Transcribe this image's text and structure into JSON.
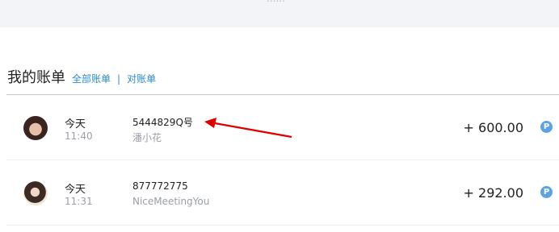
{
  "banner": {
    "text": "......"
  },
  "section": {
    "title": "我的账单",
    "link_all": "全部账单",
    "separator": "|",
    "link_reconcile": "对账单"
  },
  "rows": [
    {
      "day": "今天",
      "time": "11:40",
      "account": "5444829Q号",
      "name": "潘小花",
      "amount": "+ 600.00",
      "pay_icon": "P"
    },
    {
      "day": "今天",
      "time": "11:31",
      "account": "877772775",
      "name": "NiceMeetingYou",
      "amount": "+ 292.00",
      "pay_icon": "P"
    }
  ],
  "colors": {
    "link": "#2a8bd5",
    "arrow": "#e00000",
    "pay_icon": "#5ba3e4"
  }
}
